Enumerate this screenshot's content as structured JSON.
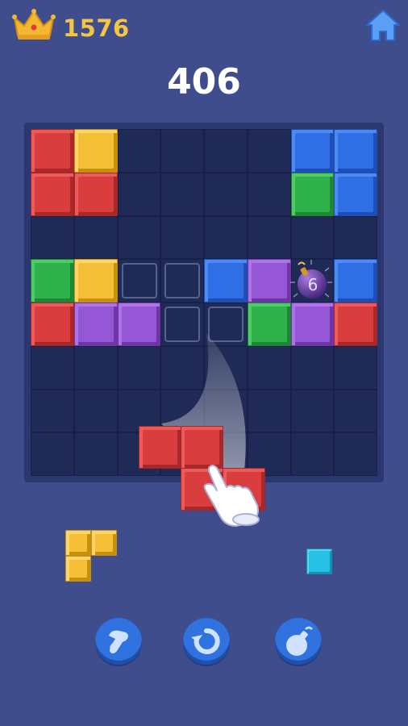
{
  "header": {
    "best_score": "1576",
    "crown_icon": "crown-icon",
    "home_icon": "home-icon"
  },
  "score": "406",
  "board": {
    "rows": 8,
    "cols": 8,
    "cells": [
      {
        "r": 0,
        "c": 0,
        "color": "red"
      },
      {
        "r": 0,
        "c": 1,
        "color": "yellow"
      },
      {
        "r": 0,
        "c": 6,
        "color": "blue"
      },
      {
        "r": 0,
        "c": 7,
        "color": "blue"
      },
      {
        "r": 1,
        "c": 0,
        "color": "red"
      },
      {
        "r": 1,
        "c": 1,
        "color": "red"
      },
      {
        "r": 1,
        "c": 6,
        "color": "green"
      },
      {
        "r": 1,
        "c": 7,
        "color": "blue"
      },
      {
        "r": 3,
        "c": 0,
        "color": "green"
      },
      {
        "r": 3,
        "c": 1,
        "color": "yellow"
      },
      {
        "r": 3,
        "c": 4,
        "color": "blue"
      },
      {
        "r": 3,
        "c": 5,
        "color": "purple"
      },
      {
        "r": 3,
        "c": 7,
        "color": "blue"
      },
      {
        "r": 4,
        "c": 0,
        "color": "red"
      },
      {
        "r": 4,
        "c": 1,
        "color": "purple"
      },
      {
        "r": 4,
        "c": 2,
        "color": "purple"
      },
      {
        "r": 4,
        "c": 5,
        "color": "green"
      },
      {
        "r": 4,
        "c": 6,
        "color": "purple"
      },
      {
        "r": 4,
        "c": 7,
        "color": "red"
      }
    ],
    "placement_preview": [
      {
        "r": 3,
        "c": 2
      },
      {
        "r": 3,
        "c": 3
      },
      {
        "r": 4,
        "c": 3
      },
      {
        "r": 4,
        "c": 4
      }
    ],
    "bomb": {
      "r": 3,
      "c": 6,
      "countdown": "6"
    }
  },
  "tray": {
    "dragging_piece": {
      "color": "red",
      "shape": "z-tetromino"
    },
    "pieces": [
      {
        "color": "yellow",
        "shape": "L-tromino"
      },
      {
        "color": "cyan",
        "shape": "single"
      }
    ]
  },
  "powerups": [
    {
      "name": "hammer-icon"
    },
    {
      "name": "refresh-icon"
    },
    {
      "name": "bomb-icon"
    }
  ],
  "colors": {
    "background": "#3f4d8c",
    "board": "#1f2a56",
    "best_score": "#f4c443",
    "red": "#d93d3d",
    "yellow": "#f5bf36",
    "blue": "#2f6fe6",
    "green": "#2fb24b",
    "purple": "#9657d6",
    "cyan": "#28c0e3",
    "button": "#2f72e0"
  }
}
